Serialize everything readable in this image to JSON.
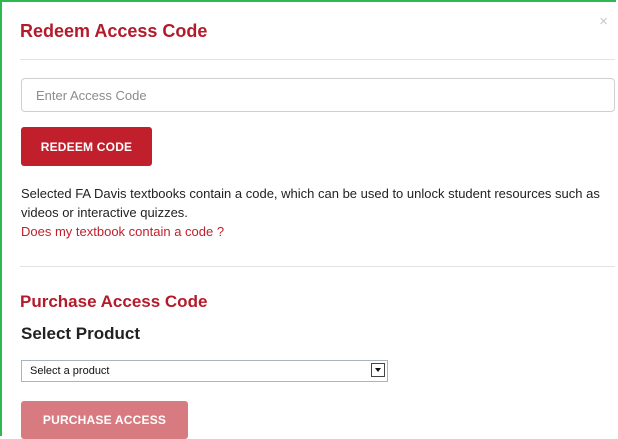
{
  "dialog": {
    "title": "Redeem Access Code",
    "close_symbol": "×"
  },
  "redeem": {
    "input_placeholder": "Enter Access Code",
    "input_value": "",
    "button_label": "REDEEM CODE",
    "description": "Selected FA Davis textbooks contain a code, which can be used to unlock student resources such as videos or interactive quizzes.",
    "help_link": "Does my textbook contain a code ?"
  },
  "purchase": {
    "title": "Purchase Access Code",
    "select_label": "Select Product",
    "select_value": "Select a product",
    "button_label": "PURCHASE ACCESS"
  },
  "icons": {
    "close": "close-icon",
    "dropdown": "chevron-down-icon"
  },
  "colors": {
    "accent": "#b31b2b",
    "primary_button": "#c11f2c",
    "disabled_button": "#d87b81",
    "link": "#c11f2c",
    "frame_border": "#2fb84f"
  }
}
